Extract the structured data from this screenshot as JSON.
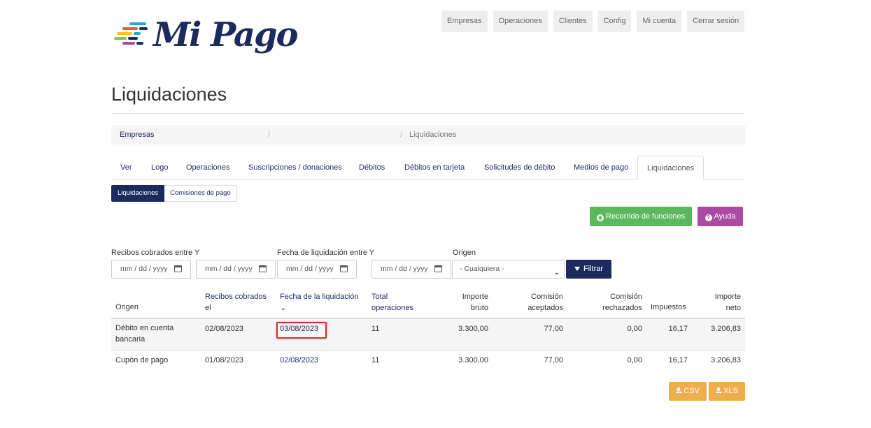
{
  "brand": {
    "name": "Mi Pago"
  },
  "topnav": [
    "Empresas",
    "Operaciones",
    "Clientes",
    "Config",
    "Mi cuenta",
    "Cerrar sesión"
  ],
  "page": {
    "title": "Liquidaciones"
  },
  "breadcrumb": {
    "root": "Empresas",
    "separator": "/",
    "current": "Liquidaciones"
  },
  "tabs": [
    "Ver",
    "Logo",
    "Operaciones",
    "Suscripciones / donaciones",
    "Débitos",
    "Débitos en tarjeta",
    "Solicitudes de débito",
    "Medios de pago",
    "Liquidaciones"
  ],
  "subtabs": [
    "Liquidaciones",
    "Comisiones de pago"
  ],
  "actions": {
    "tour": "Recorrido de funciones",
    "help": "Ayuda"
  },
  "filters": {
    "received_label": "Recibos cobrados entre Y",
    "settlement_label": "Fecha de liquidación entre Y",
    "origin_label": "Origen",
    "date_placeholder": "mm / dd / yyyy",
    "origin_value": "- Cualquiera -",
    "filter_button": "Filtrar"
  },
  "table": {
    "headers": {
      "origin": "Origen",
      "received": "Recibos cobrados el",
      "settlement": "Fecha de la liquidación",
      "total_ops": "Total operaciones",
      "gross": "Importe bruto",
      "fee_accepted": "Comisión aceptados",
      "fee_rejected": "Comisión rechazados",
      "taxes": "Impuestos",
      "net": "Importe neto"
    },
    "rows": [
      {
        "origin": "Débito en cuenta bancaria",
        "received": "02/08/2023",
        "settlement": "03/08/2023",
        "total_ops": "11",
        "gross": "3.300,00",
        "fee_accepted": "77,00",
        "fee_rejected": "0,00",
        "taxes": "16,17",
        "net": "3.206,83"
      },
      {
        "origin": "Cupón de pago",
        "received": "01/08/2023",
        "settlement": "02/08/2023",
        "total_ops": "11",
        "gross": "3.300,00",
        "fee_accepted": "77,00",
        "fee_rejected": "0,00",
        "taxes": "16,17",
        "net": "3.206,83"
      }
    ]
  },
  "exports": {
    "csv": "CSV",
    "xls": "XLS"
  },
  "colors": {
    "primary": "#1c2b5e",
    "success": "#5cb85c",
    "help": "#a94aa3",
    "export": "#f0ad4e",
    "highlight": "#d32f2f"
  }
}
